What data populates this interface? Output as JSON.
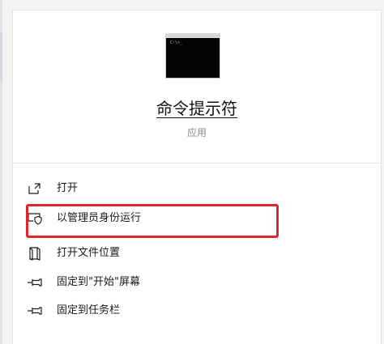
{
  "app": {
    "title": "命令提示符",
    "type_label": "应用",
    "icon": "command-prompt-icon",
    "icon_prompt_text": "C:\\>_"
  },
  "menu": {
    "items": [
      {
        "label": "打开",
        "icon": "open-icon"
      },
      {
        "label": "以管理员身份运行",
        "icon": "shield-admin-icon"
      },
      {
        "label": "打开文件位置",
        "icon": "file-location-icon"
      },
      {
        "label": "固定到\"开始\"屏幕",
        "icon": "pin-icon"
      },
      {
        "label": "固定到任务栏",
        "icon": "pin-icon"
      }
    ]
  },
  "colors": {
    "highlight_border": "#e0252b",
    "panel_background": "#ffffff",
    "page_background": "#f3f3f3"
  }
}
